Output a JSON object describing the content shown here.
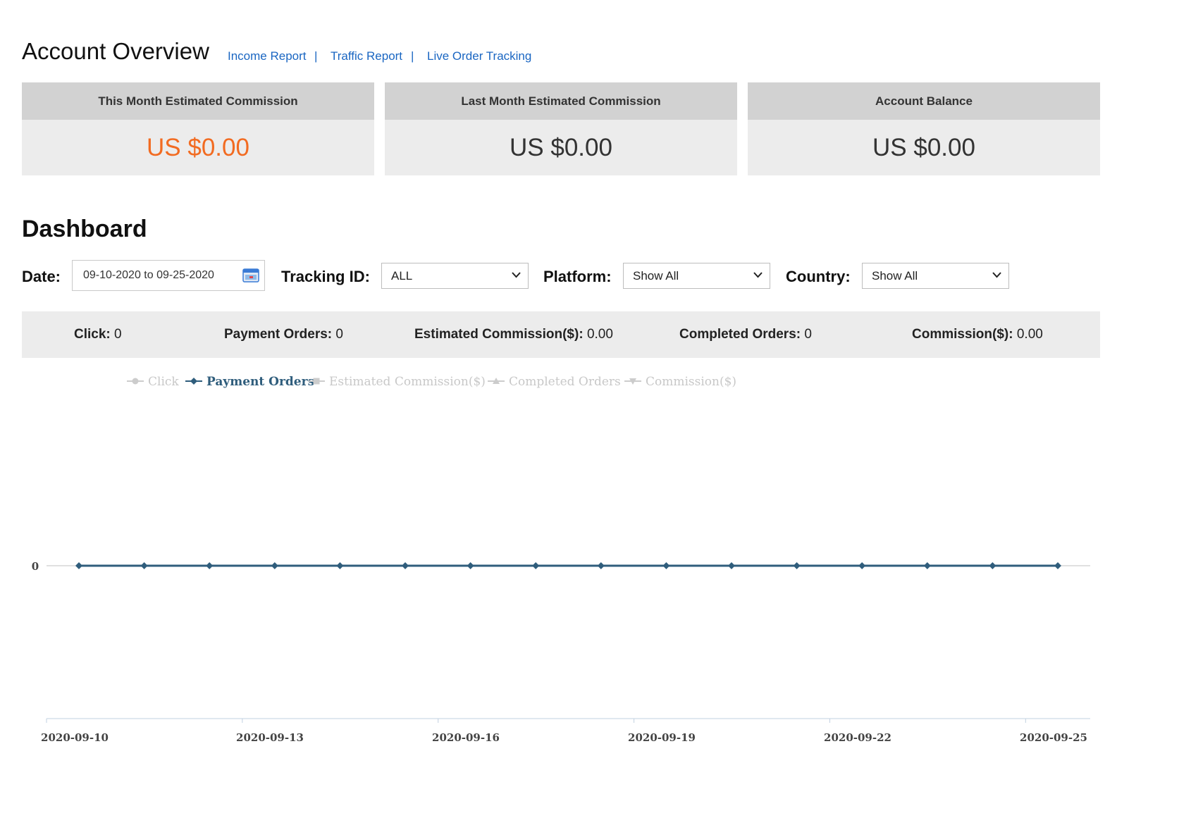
{
  "header": {
    "title": "Account Overview",
    "links": [
      "Income Report",
      "Traffic Report",
      "Live Order Tracking"
    ],
    "separator": "|"
  },
  "cards": [
    {
      "label": "This Month Estimated Commission",
      "value": "US $0.00"
    },
    {
      "label": "Last Month Estimated Commission",
      "value": "US $0.00"
    },
    {
      "label": "Account Balance",
      "value": "US $0.00"
    }
  ],
  "dashboard": {
    "title": "Dashboard",
    "filters": {
      "date_label": "Date:",
      "date_value": "09-10-2020 to 09-25-2020",
      "tracking_label": "Tracking ID:",
      "tracking_value": "ALL",
      "platform_label": "Platform:",
      "platform_value": "Show All",
      "country_label": "Country:",
      "country_value": "Show All"
    },
    "summary": [
      {
        "label": "Click:",
        "value": "0"
      },
      {
        "label": "Payment Orders:",
        "value": "0"
      },
      {
        "label": "Estimated Commission($):",
        "value": "0.00"
      },
      {
        "label": "Completed Orders:",
        "value": "0"
      },
      {
        "label": "Commission($):",
        "value": "0.00"
      }
    ]
  },
  "colors": {
    "accent": "#f26b21",
    "link": "#1a66c2",
    "series_active": "#2f5d7c",
    "series_inactive": "#cccccc"
  },
  "chart_data": {
    "type": "line",
    "legend": [
      {
        "name": "Click",
        "active": false,
        "marker": "circle"
      },
      {
        "name": "Payment Orders",
        "active": true,
        "marker": "diamond"
      },
      {
        "name": "Estimated Commission($)",
        "active": false,
        "marker": "square"
      },
      {
        "name": "Completed Orders",
        "active": false,
        "marker": "triangle"
      },
      {
        "name": "Commission($)",
        "active": false,
        "marker": "triangle-down"
      }
    ],
    "x": [
      "2020-09-10",
      "2020-09-11",
      "2020-09-12",
      "2020-09-13",
      "2020-09-14",
      "2020-09-15",
      "2020-09-16",
      "2020-09-17",
      "2020-09-18",
      "2020-09-19",
      "2020-09-20",
      "2020-09-21",
      "2020-09-22",
      "2020-09-23",
      "2020-09-24",
      "2020-09-25"
    ],
    "x_tick_labels": [
      "2020-09-10",
      "2020-09-13",
      "2020-09-16",
      "2020-09-19",
      "2020-09-22",
      "2020-09-25"
    ],
    "y_tick_labels": [
      "0"
    ],
    "series": [
      {
        "name": "Payment Orders",
        "values": [
          0,
          0,
          0,
          0,
          0,
          0,
          0,
          0,
          0,
          0,
          0,
          0,
          0,
          0,
          0,
          0
        ]
      }
    ]
  }
}
